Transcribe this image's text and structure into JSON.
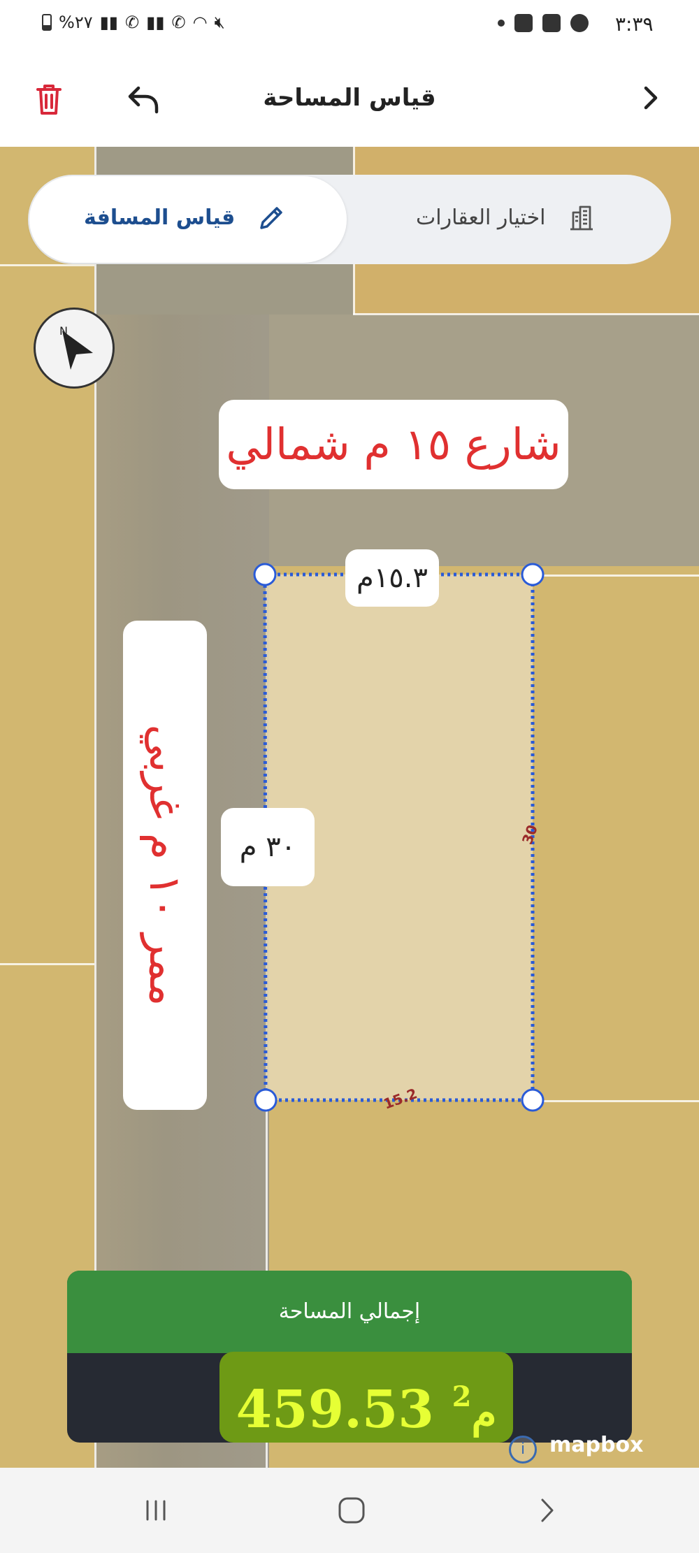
{
  "status_bar": {
    "time": "٣:٣٩",
    "battery": "%٢٧"
  },
  "app_bar": {
    "title": "قياس المساحة"
  },
  "mode_toggle": {
    "active_label": "قياس المسافة",
    "inactive_label": "اختيار العقارات"
  },
  "map_labels": {
    "street_north": "شارع ١٥ م شمالي",
    "street_west": "ممر ١٠ م غربي",
    "top_dimension": "١٥.٣م",
    "left_dimension": "٣٠ م",
    "edge_right": "30",
    "edge_bottom": "15.2"
  },
  "total_area": {
    "heading": "إجمالي المساحة",
    "value": "459.53",
    "unit": "م",
    "unit_power": "2"
  },
  "attribution": {
    "text": "mapbox"
  },
  "colors": {
    "accent_blue": "#1d4e8f",
    "polygon_blue": "#2a5bd7",
    "green_header": "#3a8f3e",
    "label_red": "#e03030",
    "area_text": "#e6ff35"
  }
}
